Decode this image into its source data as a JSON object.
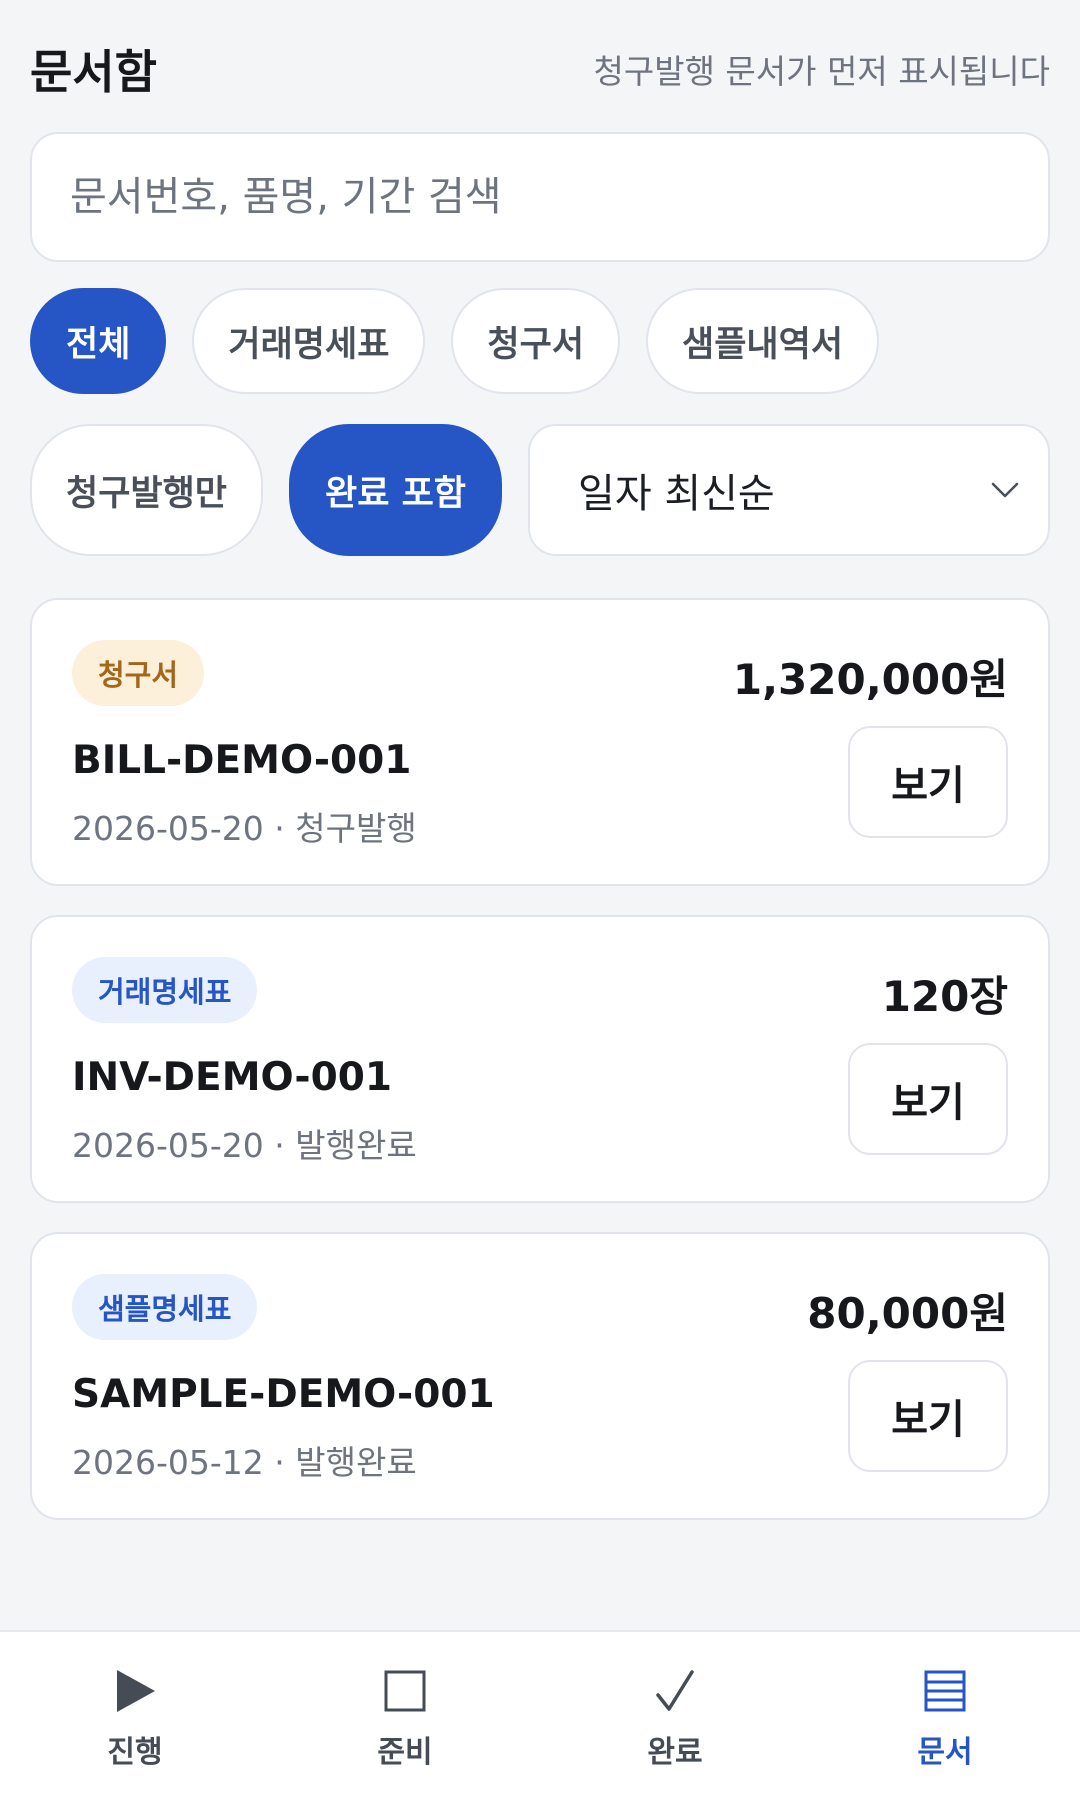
{
  "header": {
    "title": "문서함",
    "hint": "청구발행 문서가 먼저 표시됩니다"
  },
  "search": {
    "placeholder": "문서번호, 품명, 기간 검색",
    "value": ""
  },
  "type_filters": [
    {
      "label": "전체",
      "active": true
    },
    {
      "label": "거래명세표",
      "active": false
    },
    {
      "label": "청구서",
      "active": false
    },
    {
      "label": "샘플내역서",
      "active": false
    }
  ],
  "status_filters": [
    {
      "label": "청구발행만",
      "active": false
    },
    {
      "label": "완료 포함",
      "active": true
    }
  ],
  "sort": {
    "selected": "일자 최신순",
    "icon": "chevron-down-icon"
  },
  "documents": [
    {
      "badge": "청구서",
      "amount": "1,320,000원",
      "doc_no": "BILL-DEMO-001",
      "meta": "2026-05-20 · 청구발행",
      "view_label": "보기"
    },
    {
      "badge": "거래명세표",
      "amount": "120장",
      "doc_no": "INV-DEMO-001",
      "meta": "2026-05-20 · 발행완료",
      "view_label": "보기"
    },
    {
      "badge": "샘플명세표",
      "amount": "80,000원",
      "doc_no": "SAMPLE-DEMO-001",
      "meta": "2026-05-12 · 발행완료",
      "view_label": "보기"
    }
  ],
  "bottom_nav": [
    {
      "label": "진행",
      "icon": "play-icon",
      "active": false
    },
    {
      "label": "준비",
      "icon": "square-icon",
      "active": false
    },
    {
      "label": "완료",
      "icon": "check-icon",
      "active": false
    },
    {
      "label": "문서",
      "icon": "list-icon",
      "active": true
    }
  ],
  "colors": {
    "accent": "#2655c6",
    "background": "#f4f5f7",
    "warn_badge_bg": "#fdf0da",
    "warn_badge_text": "#a4661a",
    "info_badge_bg": "#e8effd"
  }
}
